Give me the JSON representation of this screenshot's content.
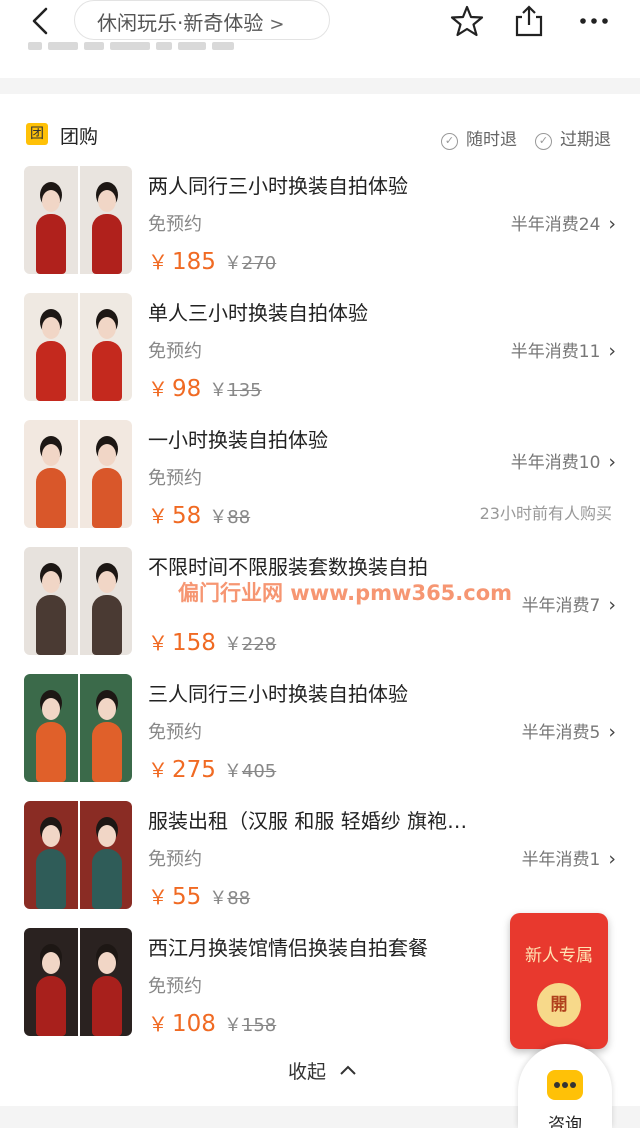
{
  "nav": {
    "breadcrumb": "休闲玩乐·新奇体验",
    "breadcrumb_chevron": ">"
  },
  "section": {
    "badge": "团",
    "title": "团购",
    "guarantees": [
      "随时退",
      "过期退"
    ]
  },
  "deals": [
    {
      "title": "两人同行三小时换装自拍体验",
      "booking": "免预约",
      "price": "185",
      "original_price": "270",
      "sales": "半年消费24",
      "recent": "",
      "colors": [
        "#b0211c",
        "#e9e4df"
      ]
    },
    {
      "title": "单人三小时换装自拍体验",
      "booking": "免预约",
      "price": "98",
      "original_price": "135",
      "sales": "半年消费11",
      "recent": "",
      "colors": [
        "#c4291e",
        "#efe9e2"
      ]
    },
    {
      "title": "一小时换装自拍体验",
      "booking": "免预约",
      "price": "58",
      "original_price": "88",
      "sales": "半年消费10",
      "recent": "23小时前有人购买",
      "colors": [
        "#d9572a",
        "#f2e8e0"
      ]
    },
    {
      "title": "不限时间不限服装套数换装自拍",
      "booking": "",
      "price": "158",
      "original_price": "228",
      "sales": "半年消费7",
      "recent": "",
      "colors": [
        "#4a3a33",
        "#e7e2dd"
      ]
    },
    {
      "title": "三人同行三小时换装自拍体验",
      "booking": "免预约",
      "price": "275",
      "original_price": "405",
      "sales": "半年消费5",
      "recent": "",
      "colors": [
        "#e0602a",
        "#3b6a4a"
      ]
    },
    {
      "title": "服装出租（汉服 和服 轻婚纱 旗袍…",
      "booking": "免预约",
      "price": "55",
      "original_price": "88",
      "sales": "半年消费1",
      "recent": "",
      "colors": [
        "#2f5c58",
        "#8a2c24"
      ]
    },
    {
      "title": "西江月换装馆情侣换装自拍套餐",
      "booking": "免预约",
      "price": "108",
      "original_price": "158",
      "sales": "",
      "recent": "",
      "colors": [
        "#a8201c",
        "#2a2220"
      ]
    }
  ],
  "watermark": "偏门行业网 www.pmw365.com",
  "currency": "￥",
  "collapse_label": "收起",
  "red_packet": {
    "title": "新人专属",
    "open": "開"
  },
  "consult_label": "咨询",
  "accent_color": "#f06a23"
}
